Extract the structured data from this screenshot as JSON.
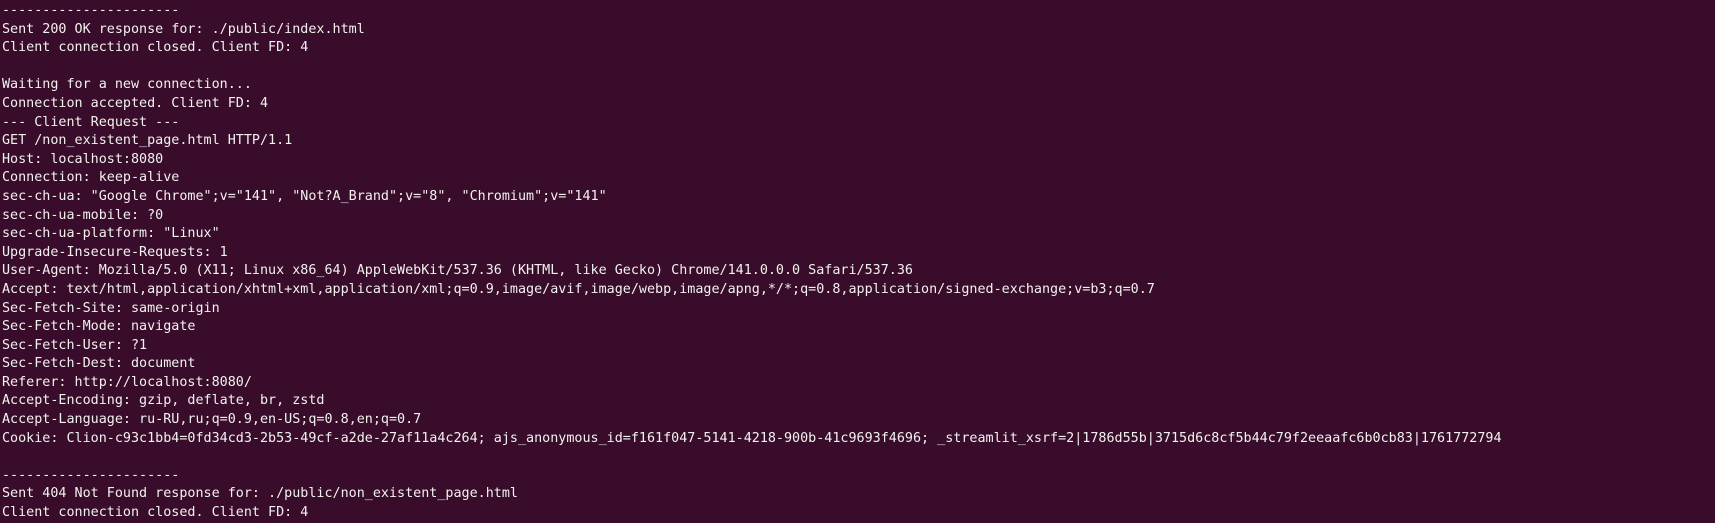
{
  "colors": {
    "background": "#380c2a",
    "foreground": "#f2f2ee"
  },
  "terminal": {
    "lines": [
      "----------------------",
      "Sent 200 OK response for: ./public/index.html",
      "Client connection closed. Client FD: 4",
      "",
      "Waiting for a new connection...",
      "Connection accepted. Client FD: 4",
      "--- Client Request ---",
      "GET /non_existent_page.html HTTP/1.1",
      "Host: localhost:8080",
      "Connection: keep-alive",
      "sec-ch-ua: \"Google Chrome\";v=\"141\", \"Not?A_Brand\";v=\"8\", \"Chromium\";v=\"141\"",
      "sec-ch-ua-mobile: ?0",
      "sec-ch-ua-platform: \"Linux\"",
      "Upgrade-Insecure-Requests: 1",
      "User-Agent: Mozilla/5.0 (X11; Linux x86_64) AppleWebKit/537.36 (KHTML, like Gecko) Chrome/141.0.0.0 Safari/537.36",
      "Accept: text/html,application/xhtml+xml,application/xml;q=0.9,image/avif,image/webp,image/apng,*/*;q=0.8,application/signed-exchange;v=b3;q=0.7",
      "Sec-Fetch-Site: same-origin",
      "Sec-Fetch-Mode: navigate",
      "Sec-Fetch-User: ?1",
      "Sec-Fetch-Dest: document",
      "Referer: http://localhost:8080/",
      "Accept-Encoding: gzip, deflate, br, zstd",
      "Accept-Language: ru-RU,ru;q=0.9,en-US;q=0.8,en;q=0.7",
      "Cookie: Clion-c93c1bb4=0fd34cd3-2b53-49cf-a2de-27af11a4c264; ajs_anonymous_id=f161f047-5141-4218-900b-41c9693f4696; _streamlit_xsrf=2|1786d55b|3715d6c8cf5b44c79f2eeaafc6b0cb83|1761772794",
      "",
      "----------------------",
      "Sent 404 Not Found response for: ./public/non_existent_page.html",
      "Client connection closed. Client FD: 4"
    ]
  }
}
